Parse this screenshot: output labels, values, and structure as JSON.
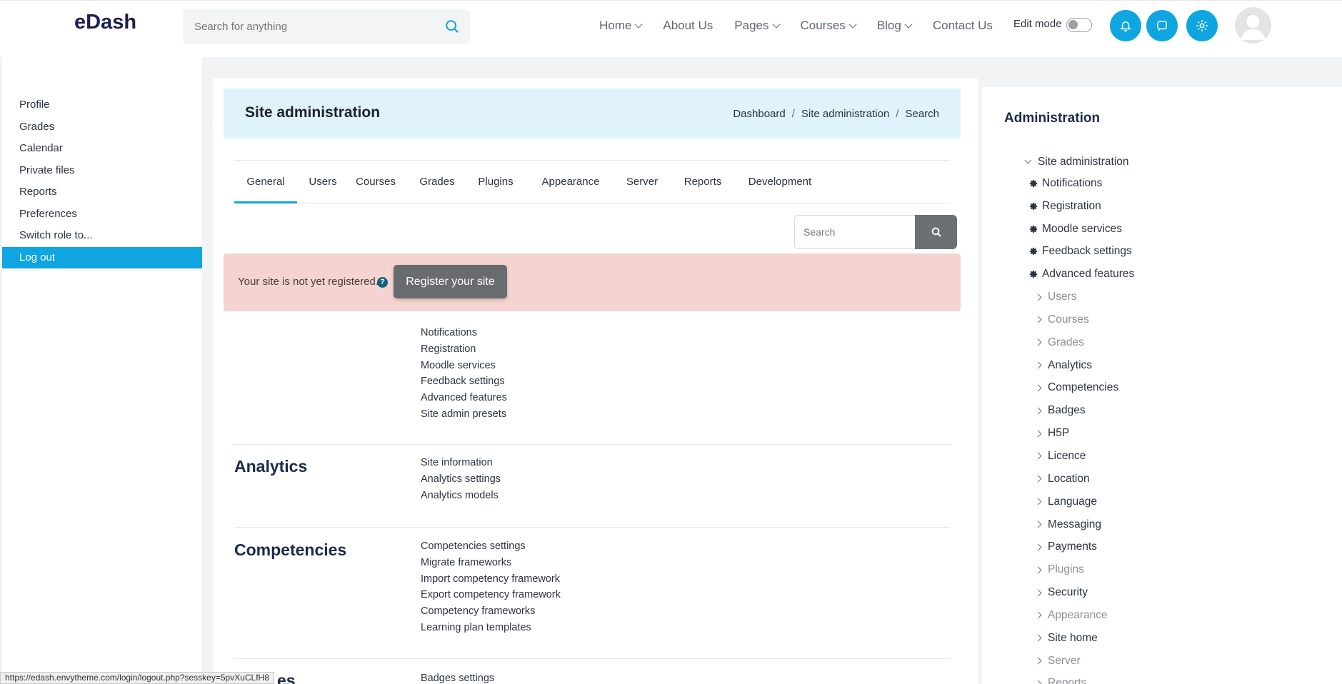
{
  "header": {
    "logo": "eDash",
    "search_placeholder": "Search for anything",
    "nav": [
      "Home",
      "About Us",
      "Pages",
      "Courses",
      "Blog",
      "Contact Us"
    ],
    "edit_mode_label": "Edit mode"
  },
  "left_nav": {
    "items": [
      "Profile",
      "Grades",
      "Calendar",
      "Private files",
      "Reports",
      "Preferences",
      "Switch role to...",
      "Log out"
    ]
  },
  "page": {
    "title": "Site administration",
    "breadcrumb": [
      "Dashboard",
      "Site administration",
      "Search"
    ],
    "tabs": [
      "General",
      "Users",
      "Courses",
      "Grades",
      "Plugins",
      "Appearance",
      "Server",
      "Reports",
      "Development"
    ],
    "search_placeholder": "Search",
    "alert_text": "Your site is not yet registered.",
    "register_button": "Register your site",
    "general_links": [
      "Notifications",
      "Registration",
      "Moodle services",
      "Feedback settings",
      "Advanced features",
      "Site admin presets"
    ],
    "analytics": {
      "title": "Analytics",
      "links": [
        "Site information",
        "Analytics settings",
        "Analytics models"
      ]
    },
    "competencies": {
      "title": "Competencies",
      "links": [
        "Competencies settings",
        "Migrate frameworks",
        "Import competency framework",
        "Export competency framework",
        "Competency frameworks",
        "Learning plan templates"
      ]
    },
    "badges": {
      "title_fragment": "es",
      "links": [
        "Badges settings"
      ]
    }
  },
  "admin_block": {
    "title": "Administration",
    "root": "Site administration",
    "settings": [
      "Notifications",
      "Registration",
      "Moodle services",
      "Feedback settings",
      "Advanced features"
    ],
    "categories": [
      {
        "label": "Users",
        "dim": true
      },
      {
        "label": "Courses",
        "dim": true
      },
      {
        "label": "Grades",
        "dim": true
      },
      {
        "label": "Analytics",
        "dim": false
      },
      {
        "label": "Competencies",
        "dim": false
      },
      {
        "label": "Badges",
        "dim": false
      },
      {
        "label": "H5P",
        "dim": false
      },
      {
        "label": "Licence",
        "dim": false
      },
      {
        "label": "Location",
        "dim": false
      },
      {
        "label": "Language",
        "dim": false
      },
      {
        "label": "Messaging",
        "dim": false
      },
      {
        "label": "Payments",
        "dim": false
      },
      {
        "label": "Plugins",
        "dim": true
      },
      {
        "label": "Security",
        "dim": false
      },
      {
        "label": "Appearance",
        "dim": true
      },
      {
        "label": "Site home",
        "dim": false
      },
      {
        "label": "Server",
        "dim": true
      },
      {
        "label": "Reports",
        "dim": true
      }
    ]
  },
  "status_url": "https://edash.envytheme.com/login/logout.php?sesskey=5pvXuCLfH8",
  "colors": {
    "accent": "#0ea5e0",
    "alert_bg": "#f5d3d0",
    "header_bg": "#e0f2fa",
    "dark_button": "#686c70"
  }
}
